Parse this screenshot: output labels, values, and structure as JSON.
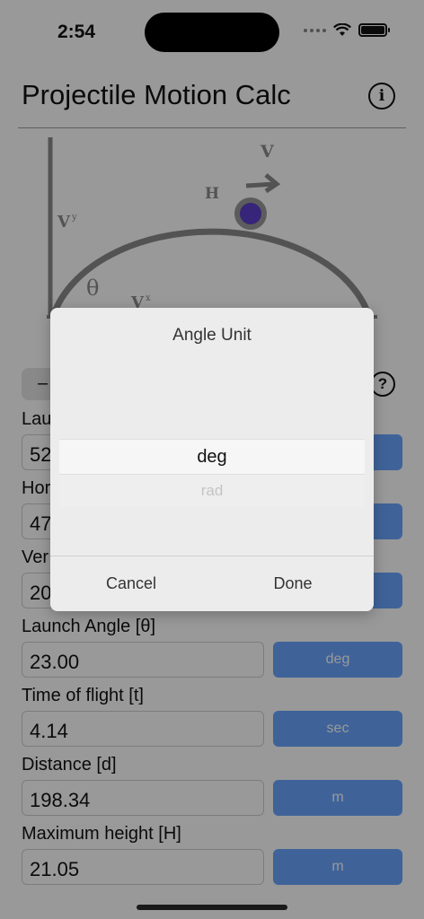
{
  "status_bar": {
    "time": "2:54"
  },
  "header": {
    "title": "Projectile Motion Calc"
  },
  "diagram": {
    "label_v": "V",
    "label_h": "H",
    "label_vy": "V",
    "label_vy_sub": "y",
    "label_vx": "V",
    "label_vx_sub": "x",
    "label_theta": "θ"
  },
  "controls": {
    "segment_label": "–",
    "help_symbol": "?"
  },
  "fields": [
    {
      "label": "Lau",
      "value": "52"
    },
    {
      "label": "Hor",
      "value": "47"
    },
    {
      "label": "Ver",
      "value": "20"
    },
    {
      "label": "Launch Angle [θ]",
      "value": "23.00",
      "unit": "deg"
    },
    {
      "label": "Time of flight [t]",
      "value": "4.14",
      "unit": "sec"
    },
    {
      "label": "Distance [d]",
      "value": "198.34",
      "unit": "m"
    },
    {
      "label": "Maximum height [H]",
      "value": "21.05",
      "unit": "m"
    }
  ],
  "picker": {
    "title": "Angle Unit",
    "options": [
      "deg",
      "rad"
    ],
    "selected": "deg",
    "cancel_label": "Cancel",
    "done_label": "Done"
  },
  "colors": {
    "accent": "#69a5ff",
    "ball": "#5a3ec8",
    "diagram_gray": "#8a8a8a"
  }
}
